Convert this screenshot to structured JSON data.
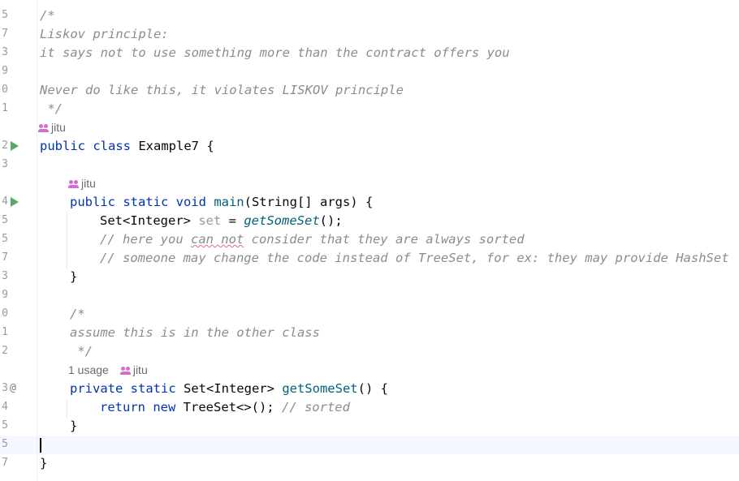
{
  "editor": {
    "gutter_numbers": [
      "5",
      "7",
      "3",
      "9",
      "0",
      "1",
      "",
      "2",
      "3",
      "",
      "4",
      "5",
      "5",
      "7",
      "3",
      "9",
      "0",
      "1",
      "2",
      "",
      "3",
      "4",
      "5",
      "5",
      "7"
    ],
    "author": "jitu",
    "usage_hint": "1 usage",
    "lines": {
      "l1": "/*",
      "l2": "Liskov principle:",
      "l3": "it says not to use something more than the contract offers you",
      "l5": "Never do like this, it violates LISKOV principle",
      "l6": " */",
      "class_kw": "public class ",
      "class_name": "Example7 {",
      "main_kw": "public static void ",
      "main_name": "main",
      "main_rest": "(String[] args) {",
      "set_type": "Set<Integer> ",
      "set_var": "set",
      "set_eq": " = ",
      "set_call": "getSomeSet",
      "set_end": "();",
      "c1_a": "// here you ",
      "c1_typo": "can not",
      "c1_b": " consider that they are always sorted",
      "c2": "// someone may change the code instead of TreeSet, for ex: they may provide HashSet",
      "close_brace": "}",
      "c3": "/*",
      "c4": "assume this is in the other class",
      "c5": " */",
      "gs_kw": "private static ",
      "gs_type": "Set<Integer> ",
      "gs_name": "getSomeSet",
      "gs_rest": "() {",
      "ret_kw": "return new ",
      "ret_type": "TreeSet<>(); ",
      "ret_comment": "// sorted",
      "final_brace": "}"
    },
    "icons": {
      "run": "run-gutter-icon",
      "override": "at-sign-icon",
      "author": "users-icon"
    },
    "colors": {
      "keyword": "#0033b3",
      "comment": "#8c8c8c",
      "method": "#00627a",
      "run_icon": "#59a869",
      "author_icon": "#d36ed1"
    }
  }
}
